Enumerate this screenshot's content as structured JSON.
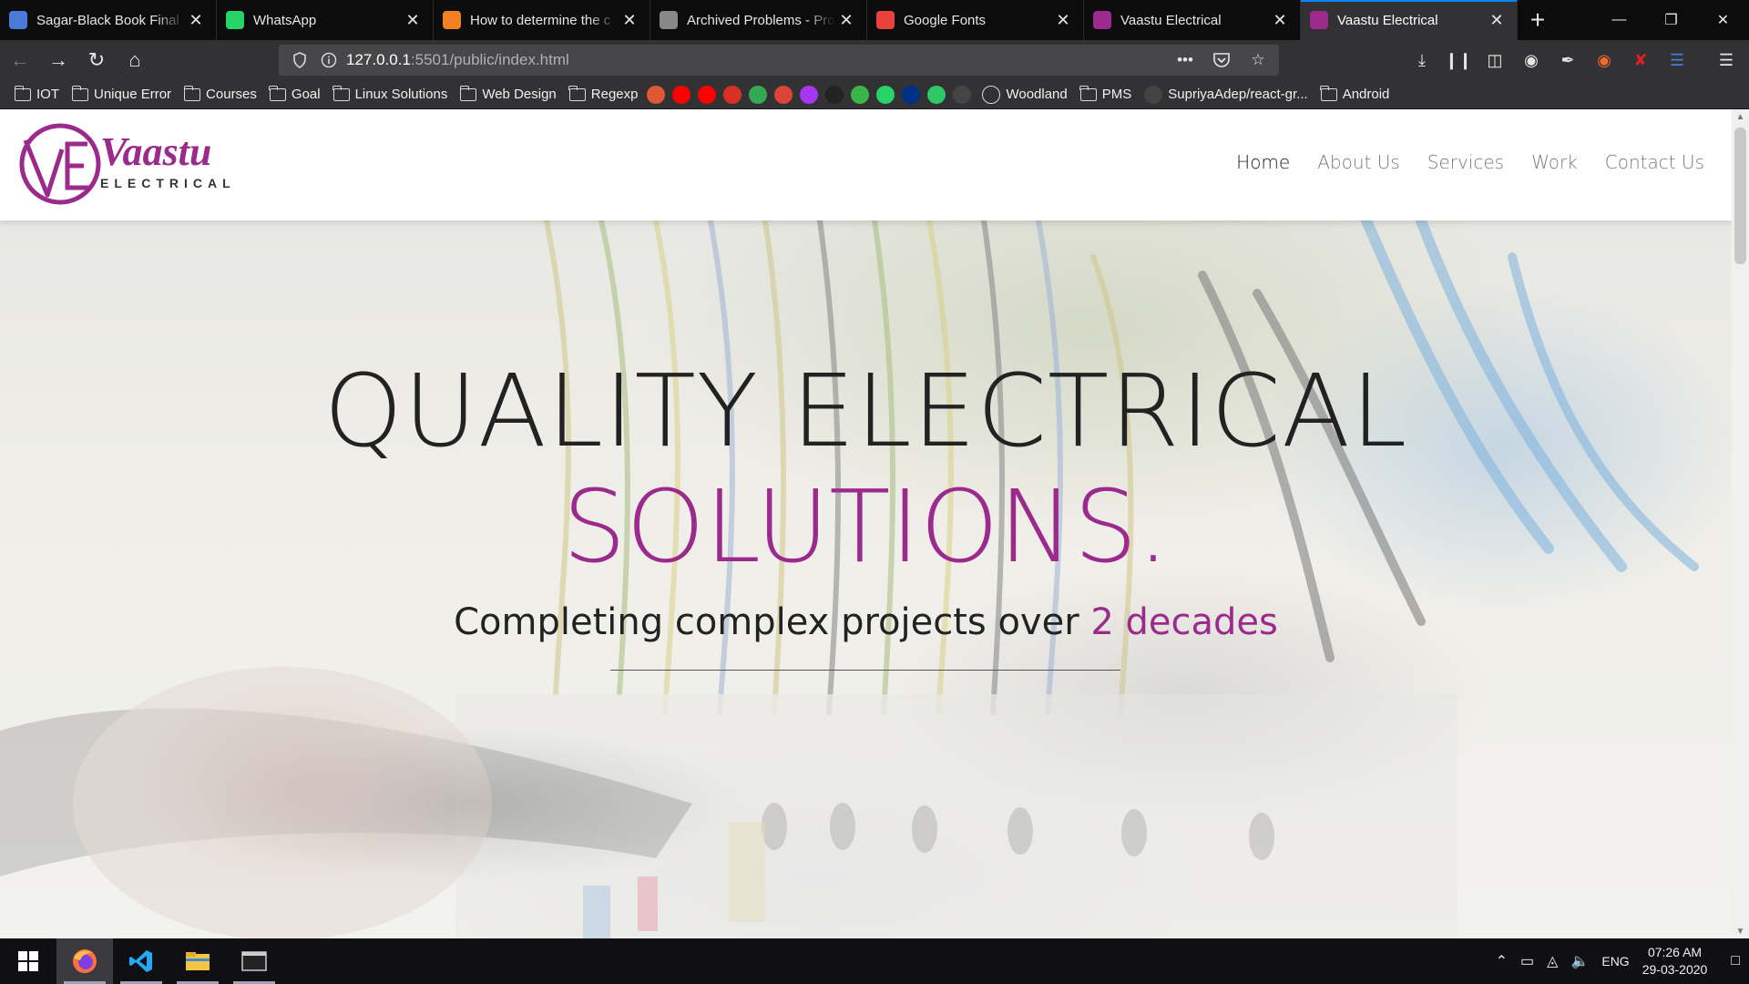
{
  "browser": {
    "tabs": [
      {
        "title": "Sagar-Black Book Final",
        "icon": "docs-icon",
        "color": "#4a7bd8"
      },
      {
        "title": "WhatsApp",
        "icon": "whatsapp-icon",
        "color": "#25d366"
      },
      {
        "title": "How to determine the c",
        "icon": "stackoverflow-icon",
        "color": "#f48024"
      },
      {
        "title": "Archived Problems - Pro",
        "icon": "projecteuler-icon",
        "color": "#888888"
      },
      {
        "title": "Google Fonts",
        "icon": "googlefonts-icon",
        "color": "#e8433b"
      },
      {
        "title": "Vaastu Electrical",
        "icon": "vaastu-icon",
        "color": "#9c2a8c"
      },
      {
        "title": "Vaastu Electrical",
        "icon": "vaastu-icon",
        "color": "#9c2a8c",
        "active": true
      }
    ],
    "url_host": "127.0.0.1",
    "url_path": ":5501/public/index.html",
    "bookmarks": [
      {
        "label": "IOT",
        "type": "folder"
      },
      {
        "label": "Unique Error",
        "type": "folder"
      },
      {
        "label": "Courses",
        "type": "folder"
      },
      {
        "label": "Goal",
        "type": "folder"
      },
      {
        "label": "Linux Solutions",
        "type": "folder"
      },
      {
        "label": "Web Design",
        "type": "folder"
      },
      {
        "label": "Regexp",
        "type": "folder"
      }
    ],
    "bookmark_icons": [
      {
        "name": "duckduckgo-bookmark-icon",
        "color": "#de5833"
      },
      {
        "name": "youtube-music-bookmark-icon",
        "color": "#ff0000"
      },
      {
        "name": "youtube-bookmark-icon",
        "color": "#ff0000"
      },
      {
        "name": "gmail-bookmark-icon",
        "color": "#d93025"
      },
      {
        "name": "drive-bookmark-icon",
        "color": "#34a853"
      },
      {
        "name": "chrome-bookmark-icon",
        "color": "#db4437"
      },
      {
        "name": "udemy-bookmark-icon",
        "color": "#a435f0"
      },
      {
        "name": "amazon-bookmark-icon",
        "color": "#222222"
      },
      {
        "name": "play-bookmark-icon",
        "color": "#3bb54a"
      },
      {
        "name": "whatsapp-bookmark-icon",
        "color": "#25d366"
      },
      {
        "name": "paypal-bookmark-icon",
        "color": "#003087"
      },
      {
        "name": "hackerrank-bookmark-icon",
        "color": "#2ec866"
      },
      {
        "name": "github-bookmark-icon",
        "color": "#444444"
      }
    ],
    "bookmarks_tail": [
      {
        "label": "Woodland",
        "type": "globe"
      },
      {
        "label": "PMS",
        "type": "folder"
      },
      {
        "label": "SupriyaAdep/react-gr...",
        "type": "github"
      },
      {
        "label": "Android",
        "type": "folder"
      }
    ]
  },
  "site": {
    "logo_name": "Vaastu",
    "logo_sub": "ELECTRICAL",
    "nav": [
      "Home",
      "About Us",
      "Services",
      "Work",
      "Contact Us"
    ],
    "hero_line1": "QUALITY ELECTRICAL",
    "hero_line2": "SOLUTIONS.",
    "tagline_main": "Completing complex projects over ",
    "tagline_accent": "2 decades",
    "accent_color": "#9c2a8c"
  },
  "taskbar": {
    "apps": [
      "firefox-icon",
      "vscode-icon",
      "file-explorer-icon",
      "terminal-icon"
    ],
    "language": "ENG",
    "time": "07:26 AM",
    "date": "29-03-2020"
  }
}
